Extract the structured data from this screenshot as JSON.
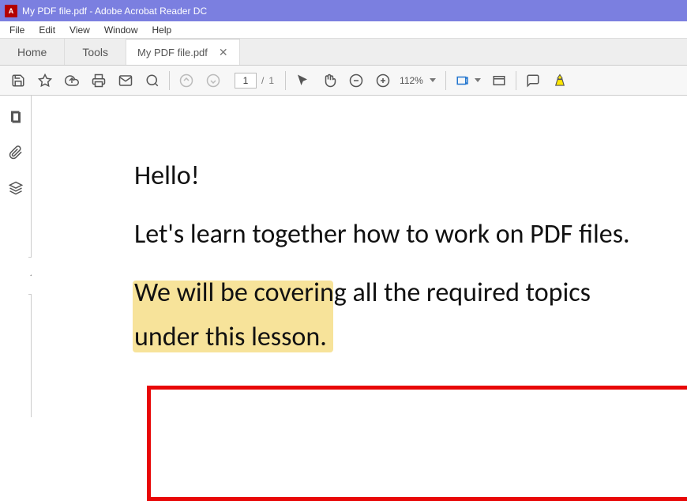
{
  "title": "My PDF file.pdf - Adobe Acrobat Reader DC",
  "menubar": {
    "file": "File",
    "edit": "Edit",
    "view": "View",
    "window": "Window",
    "help": "Help"
  },
  "tabs": {
    "home": "Home",
    "tools": "Tools",
    "doc": "My PDF file.pdf"
  },
  "toolbar": {
    "page_current": "1",
    "page_sep": "/",
    "page_total": "1",
    "zoom": "112%"
  },
  "document": {
    "line1": "Hello!",
    "line2": "Let's learn together how to work on PDF files.",
    "line3": "We will be covering all the required topics under this lesson."
  }
}
